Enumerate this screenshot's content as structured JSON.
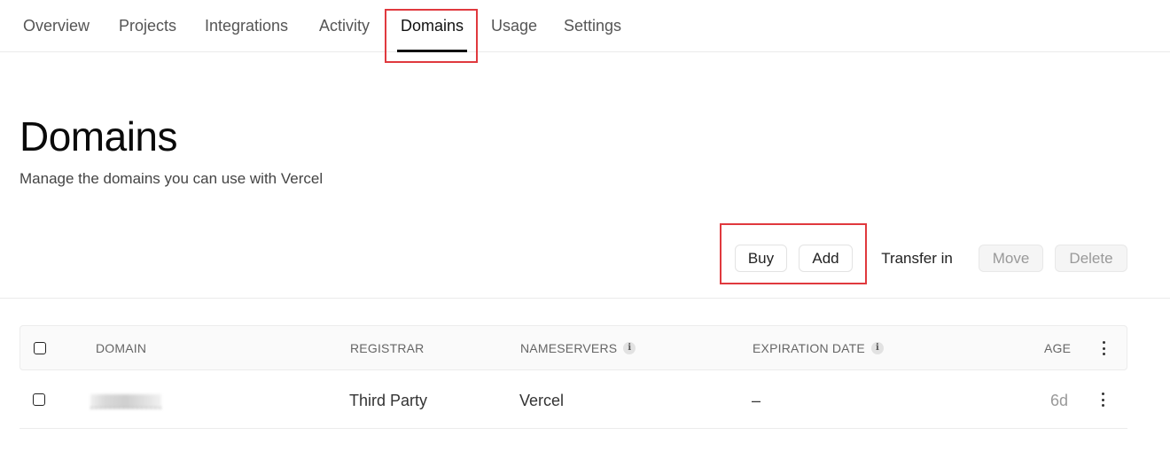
{
  "nav": {
    "tabs": [
      {
        "label": "Overview"
      },
      {
        "label": "Projects"
      },
      {
        "label": "Integrations"
      },
      {
        "label": "Activity"
      },
      {
        "label": "Domains"
      },
      {
        "label": "Usage"
      },
      {
        "label": "Settings"
      }
    ],
    "active": "Domains"
  },
  "header": {
    "title": "Domains",
    "subtitle": "Manage the domains you can use with Vercel"
  },
  "actions": {
    "buy": "Buy",
    "add": "Add",
    "transfer_in": "Transfer in",
    "move": "Move",
    "delete": "Delete"
  },
  "table": {
    "columns": {
      "domain": "DOMAIN",
      "registrar": "REGISTRAR",
      "nameservers": "NAMESERVERS",
      "expiration": "EXPIRATION DATE",
      "age": "AGE"
    },
    "rows": [
      {
        "registrar": "Third Party",
        "nameservers": "Vercel",
        "expiration": "–",
        "age": "6d"
      }
    ]
  },
  "colors": {
    "highlight": "#e0393e",
    "active_underline": "#111111"
  },
  "icons": {
    "info": "info-icon",
    "more": "kebab-menu-icon"
  }
}
